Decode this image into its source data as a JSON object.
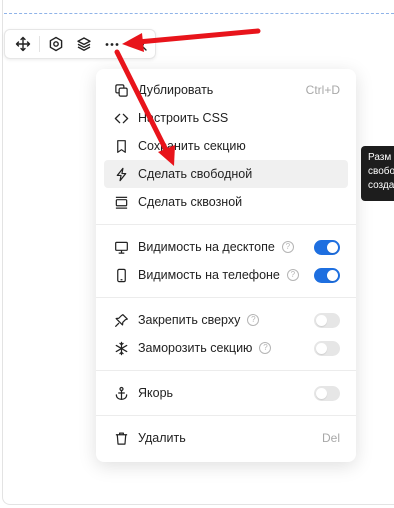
{
  "toolbar": {
    "buttons": [
      {
        "name": "move-icon"
      },
      {
        "name": "settings-icon"
      },
      {
        "name": "layers-icon"
      },
      {
        "name": "more-icon"
      }
    ]
  },
  "menu": {
    "groups": [
      [
        {
          "label": "Дублировать",
          "icon": "duplicate-icon",
          "shortcut": "Ctrl+D"
        },
        {
          "label": "Настроить CSS",
          "icon": "code-icon"
        },
        {
          "label": "Сохранить секцию",
          "icon": "bookmark-icon"
        },
        {
          "label": "Сделать свободной",
          "icon": "bolt-icon",
          "highlighted": true
        },
        {
          "label": "Сделать сквозной",
          "icon": "through-section-icon"
        }
      ],
      [
        {
          "label": "Видимость на десктопе",
          "icon": "desktop-icon",
          "help": true,
          "toggle": true
        },
        {
          "label": "Видимость на телефоне",
          "icon": "phone-icon",
          "help": true,
          "toggle": true
        }
      ],
      [
        {
          "label": "Закрепить сверху",
          "icon": "pin-icon",
          "help": true,
          "toggle": false
        },
        {
          "label": "Заморозить секцию",
          "icon": "snowflake-icon",
          "help": true,
          "toggle": false
        }
      ],
      [
        {
          "label": "Якорь",
          "icon": "anchor-icon",
          "toggle": false
        }
      ],
      [
        {
          "label": "Удалить",
          "icon": "trash-icon",
          "shortcut": "Del"
        }
      ]
    ]
  },
  "tooltip": {
    "lines": [
      "Разм",
      "свобо",
      "созда"
    ]
  },
  "colors": {
    "accent": "#1e6fe0",
    "arrow": "#e8141b",
    "tooltip_bg": "#1d1d1d"
  }
}
